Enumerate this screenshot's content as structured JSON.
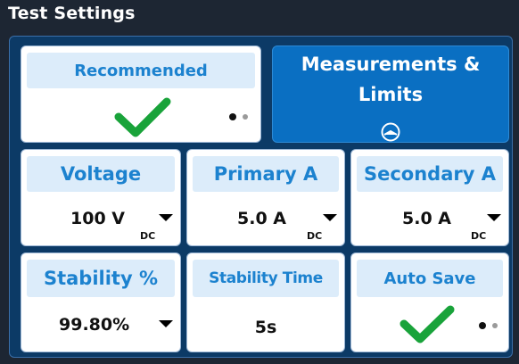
{
  "window": {
    "title": "Test Settings"
  },
  "tabs": {
    "recommended": {
      "label": "Recommended",
      "checked": true
    },
    "measurements": {
      "label_line1": "Measurements &",
      "label_line2": "Limits"
    }
  },
  "settings": {
    "voltage": {
      "label": "Voltage",
      "value": "100 V",
      "unit": "DC"
    },
    "primary": {
      "label": "Primary A",
      "value": "5.0 A",
      "unit": "DC"
    },
    "secondary": {
      "label": "Secondary A",
      "value": "5.0 A",
      "unit": "DC"
    },
    "stability_pct": {
      "label": "Stability %",
      "value": "99.80%"
    },
    "stability_time": {
      "label": "Stability Time",
      "value": "5s"
    },
    "auto_save": {
      "label": "Auto Save",
      "checked": true
    }
  },
  "colors": {
    "accent_blue": "#1c82cf",
    "active_blue": "#0a6fc2",
    "header_bg": "#dcecfa",
    "check_green": "#19a33a"
  }
}
